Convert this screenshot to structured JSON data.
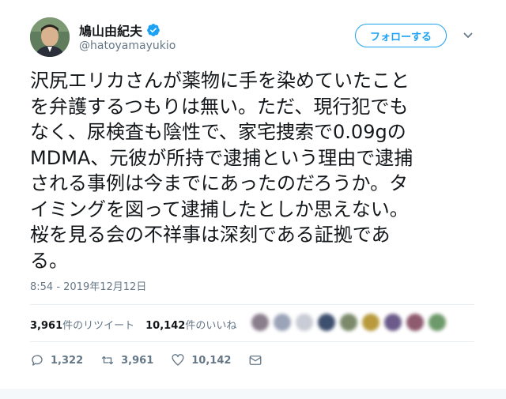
{
  "user": {
    "display_name": "鳩山由紀夫",
    "handle": "@hatoyamayukio",
    "verified_icon": "verified-badge-icon"
  },
  "follow_label": "フォローする",
  "tweet": {
    "lines": [
      "沢尻エリカさんが薬物に手を染めていたこと",
      "を弁護するつもりは無い。ただ、現行犯でも",
      "なく、尿検査も陰性で、家宅捜索で0.09gの",
      "MDMA、元彼が所持で逮捕という理由で逮捕",
      "される事例は今までにあったのだろうか。タ",
      "イミングを図って逮捕したとしか思えない。",
      "桜を見る会の不祥事は深刻である証拠であ",
      "る。"
    ],
    "timestamp": "8:54 - 2019年12月12日"
  },
  "stats": {
    "retweets_count": "3,961",
    "retweets_label": "件のリツイート",
    "likes_count": "10,142",
    "likes_label": "件のいいね"
  },
  "actions": {
    "reply_count": "1,322",
    "retweet_count": "3,961",
    "like_count": "10,142"
  },
  "colors": {
    "accent": "#1da1f2",
    "text": "#14171a",
    "muted": "#657786"
  }
}
